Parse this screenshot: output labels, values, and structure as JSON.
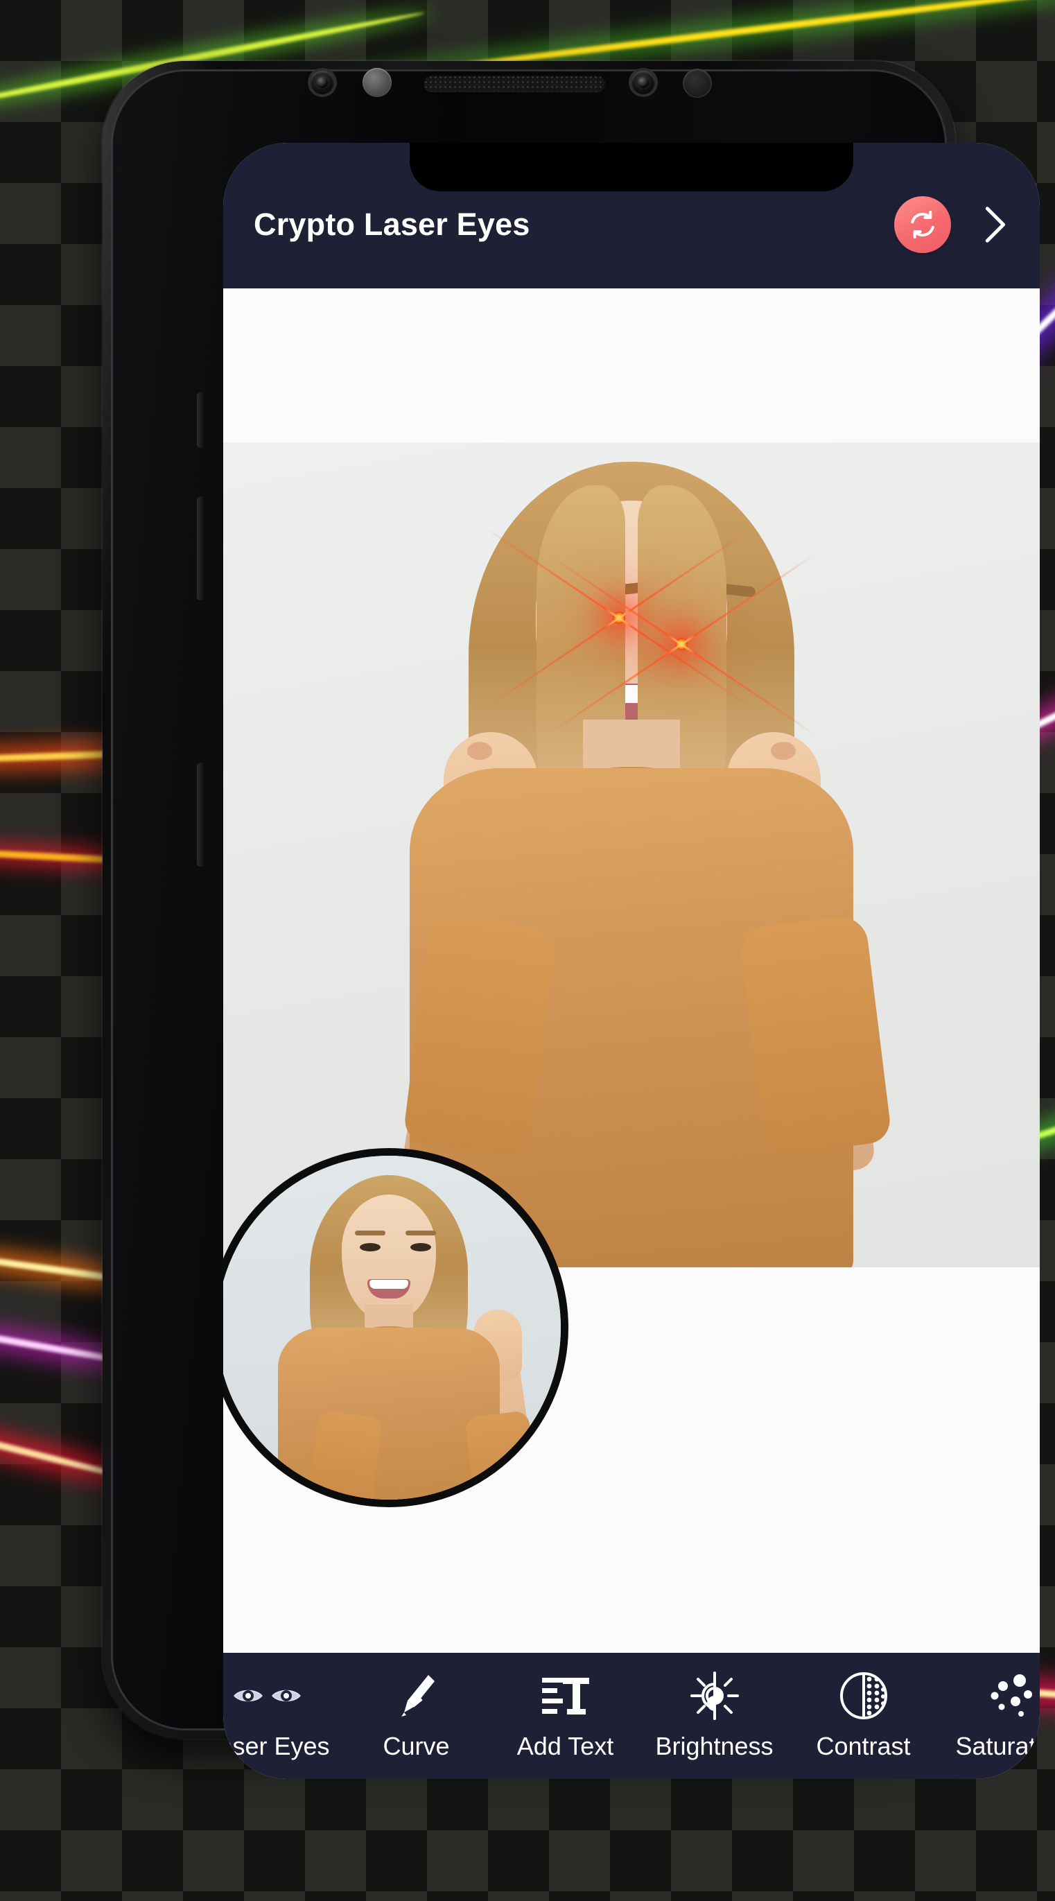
{
  "app": {
    "title": "Crypto Laser Eyes",
    "theme": {
      "appbar_bg": "#1e2036",
      "accent": "#f5696e",
      "canvas_bg": "#fbfbfb",
      "toolbar_bg": "#1e2036"
    }
  },
  "appbar": {
    "title": "Crypto Laser Eyes",
    "refresh_icon": "refresh-icon",
    "next_icon": "chevron-right-icon"
  },
  "canvas": {
    "photo_alt": "Smiling blonde woman giving two thumbs up with red laser eyes effect applied",
    "effect": "laser-eyes",
    "preview_alt": "Circular thumbnail of original photo without laser eyes"
  },
  "toolbar": {
    "items": [
      {
        "label": "Laser Eyes",
        "icon": "laser-eyes-icon",
        "selected": true
      },
      {
        "label": "Curve",
        "icon": "pen-curve-icon",
        "selected": false
      },
      {
        "label": "Add Text",
        "icon": "add-text-icon",
        "selected": false
      },
      {
        "label": "Brightness",
        "icon": "brightness-sun-icon",
        "selected": false
      },
      {
        "label": "Contrast",
        "icon": "contrast-circle-icon",
        "selected": false
      },
      {
        "label": "Saturation",
        "icon": "saturation-dots-icon",
        "selected": false
      }
    ]
  },
  "background": {
    "pattern": "dark-checkerboard",
    "beams": [
      {
        "name": "beam-yellow-green-top",
        "color": "#ffe21a",
        "glow": "#4aa81e"
      },
      {
        "name": "beam-green-top-left",
        "color": "#c9f542",
        "glow": "#3f9a22"
      },
      {
        "name": "beam-violet-right",
        "color": "#ffffff",
        "glow": "#6a21d8"
      },
      {
        "name": "beam-orange-left",
        "color": "#ffd24a",
        "glow": "#ef4b14"
      },
      {
        "name": "beam-red-left-mid",
        "color": "#ffe27a",
        "glow": "#e01a2a"
      },
      {
        "name": "beam-pink-right-mid",
        "color": "#ffffff",
        "glow": "#d4259a"
      },
      {
        "name": "beam-crimson-bottom",
        "color": "#ffe9a0",
        "glow": "#e8134e"
      },
      {
        "name": "beam-amber-bottom-left",
        "color": "#fff0a0",
        "glow": "#e86a10"
      }
    ]
  }
}
